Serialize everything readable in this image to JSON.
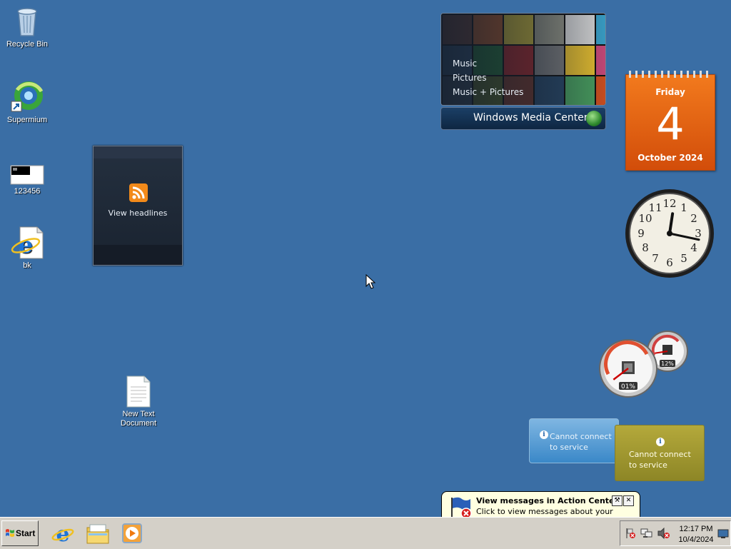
{
  "desktop_icons": [
    {
      "label": "Recycle Bin",
      "icon": "recycle-bin-icon"
    },
    {
      "label": "Supermium",
      "icon": "supermium-icon"
    },
    {
      "label": "123456",
      "icon": "image-file-icon"
    },
    {
      "label": "bk",
      "icon": "internet-shortcut-icon"
    },
    {
      "label": "New Text Document",
      "icon": "text-document-icon"
    }
  ],
  "feed_gadget": {
    "label": "View headlines"
  },
  "media_center": {
    "menu": [
      "Music",
      "Pictures",
      "Music + Pictures"
    ],
    "brand": "Windows Media Center"
  },
  "calendar": {
    "day_name": "Friday",
    "day_number": "4",
    "month_year": "October 2024"
  },
  "clock": {
    "hour": 12,
    "minute": 17
  },
  "cpu_meter": {
    "cpu_label": "01%",
    "memory_label": "12%",
    "cpu_percent": 1,
    "memory_percent": 12
  },
  "weather_gadget": {
    "line1": "Cannot connect",
    "line2": "to service"
  },
  "currency_gadget": {
    "line1": "Cannot connect",
    "line2": "to service"
  },
  "balloon": {
    "title": "View messages in Action Center",
    "body": "Click to view messages about your computer."
  },
  "taskbar": {
    "start_label": "Start",
    "pinned": [
      "internet-explorer-icon",
      "windows-explorer-icon",
      "media-player-icon"
    ],
    "time": "12:17 PM",
    "date": "10/4/2024"
  }
}
